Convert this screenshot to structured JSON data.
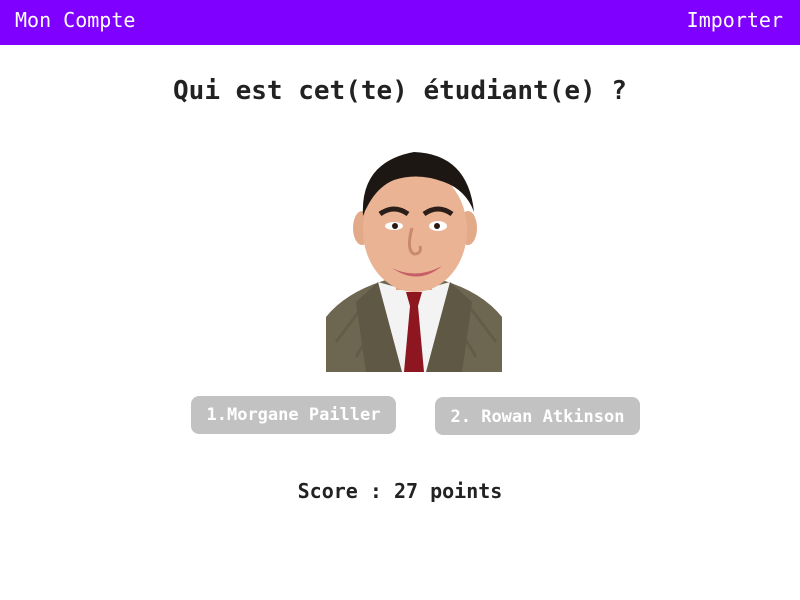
{
  "header": {
    "account_label": "Mon Compte",
    "import_label": "Importer",
    "bar_color": "#7F00FF"
  },
  "quiz": {
    "question": "Qui est cet(te) étudiant(e) ?",
    "answers": [
      {
        "label": "1.Morgane Pailler"
      },
      {
        "label": "2. Rowan Atkinson"
      }
    ],
    "answer_button_color": "#C2C2C2"
  },
  "score": {
    "text": "Score : 27 points"
  }
}
